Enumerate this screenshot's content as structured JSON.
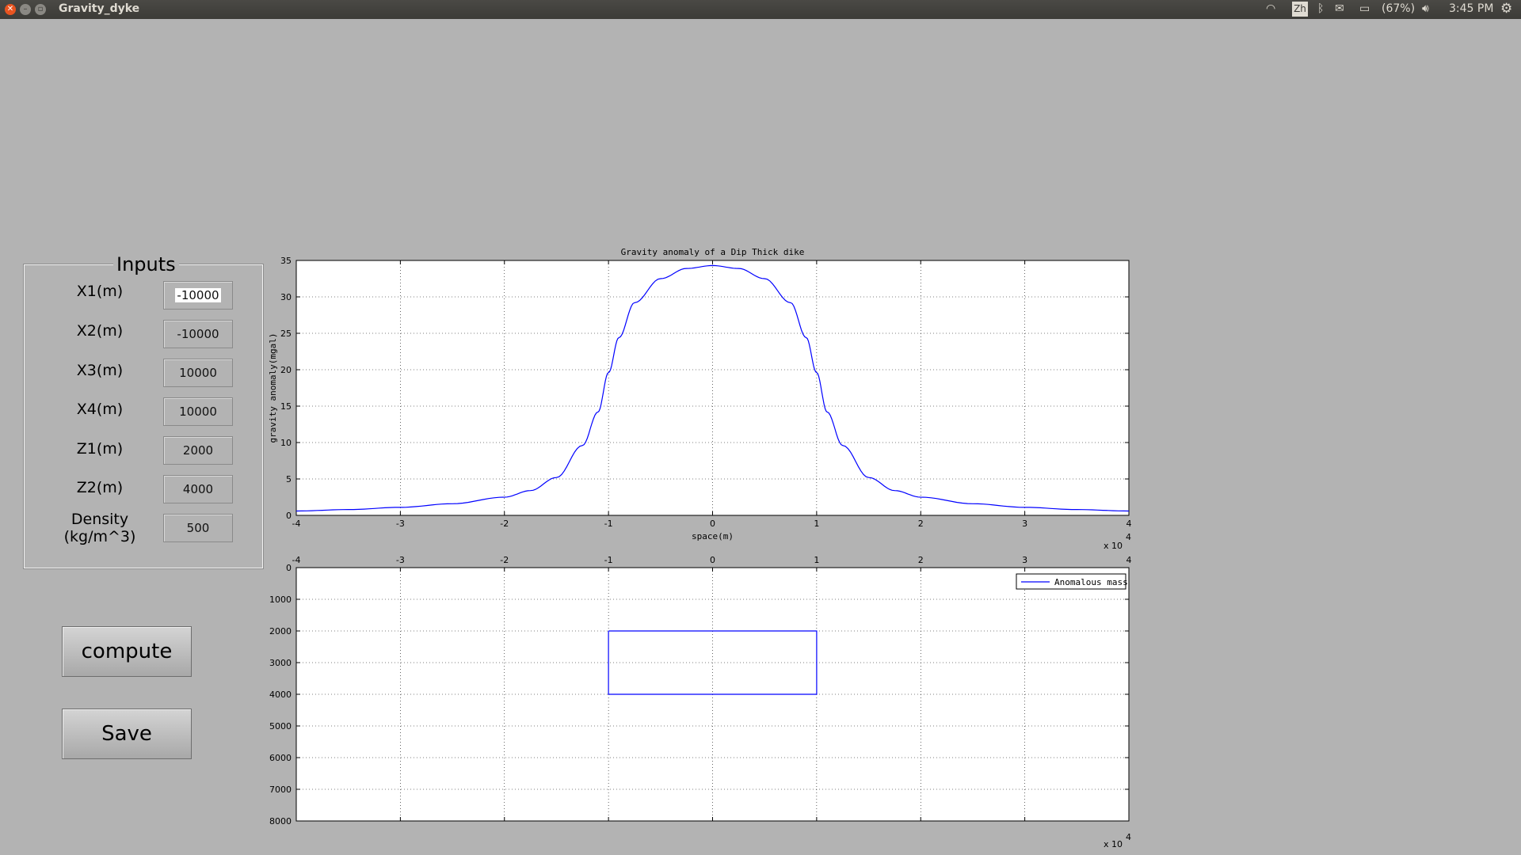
{
  "window": {
    "title": "Gravity_dyke",
    "tray": {
      "input_method": "Zh",
      "battery": "(67%)",
      "clock": "3:45 PM"
    },
    "icons": [
      "close-icon",
      "minimize-icon",
      "maximize-icon",
      "wifi-icon",
      "bluetooth-icon",
      "mail-icon",
      "battery-icon",
      "volume-icon",
      "gear-icon"
    ]
  },
  "inputs": {
    "title": "Inputs",
    "fields": [
      {
        "label": "X1(m)",
        "value": "-10000"
      },
      {
        "label": "X2(m)",
        "value": "-10000"
      },
      {
        "label": "X3(m)",
        "value": "10000"
      },
      {
        "label": "X4(m)",
        "value": "10000"
      },
      {
        "label": "Z1(m)",
        "value": "2000"
      },
      {
        "label": "Z2(m)",
        "value": "4000"
      },
      {
        "label": "Density\n(kg/m^3)",
        "value": "500"
      }
    ]
  },
  "buttons": {
    "compute": "compute",
    "save": "Save"
  },
  "chart_data": [
    {
      "type": "line",
      "title": "Gravity anomaly of a Dip Thick dike",
      "xlabel": "space(m)",
      "ylabel": "gravity anomaly(mgal)",
      "x_multiplier": "x 10",
      "x_multiplier_exp": "4",
      "xlim": [
        -40000,
        40000
      ],
      "ylim": [
        0,
        35
      ],
      "xticks": [
        "-4",
        "-3",
        "-2",
        "-1",
        "0",
        "1",
        "2",
        "3",
        "4"
      ],
      "yticks": [
        "0",
        "5",
        "10",
        "15",
        "20",
        "25",
        "30",
        "35"
      ],
      "grid": true,
      "series": [
        {
          "color": "#0000ff",
          "x": [
            -40000,
            -35000,
            -30000,
            -25000,
            -20000,
            -17500,
            -15000,
            -12500,
            -11000,
            -10000,
            -9000,
            -7500,
            -5000,
            -2500,
            0,
            2500,
            5000,
            7500,
            9000,
            10000,
            11000,
            12500,
            15000,
            17500,
            20000,
            25000,
            30000,
            35000,
            40000
          ],
          "y": [
            0.6,
            0.8,
            1.1,
            1.6,
            2.5,
            3.4,
            5.2,
            9.6,
            14.2,
            19.6,
            24.4,
            29.2,
            32.5,
            33.9,
            34.3,
            33.9,
            32.5,
            29.2,
            24.4,
            19.6,
            14.2,
            9.6,
            5.2,
            3.4,
            2.5,
            1.6,
            1.1,
            0.8,
            0.6
          ]
        }
      ]
    },
    {
      "type": "line",
      "title": "",
      "legend": "Anomalous mass",
      "legend_position": "top-right",
      "x_multiplier": "x 10",
      "x_multiplier_exp": "4",
      "xlim": [
        -40000,
        40000
      ],
      "ylim": [
        8000,
        0
      ],
      "xticks": [
        "-4",
        "-3",
        "-2",
        "-1",
        "0",
        "1",
        "2",
        "3",
        "4"
      ],
      "yticks": [
        "0",
        "1000",
        "2000",
        "3000",
        "4000",
        "5000",
        "6000",
        "7000",
        "8000"
      ],
      "x_axis_location": "top",
      "grid": true,
      "series": [
        {
          "name": "Anomalous mass",
          "color": "#0000ff",
          "x": [
            -10000,
            10000,
            10000,
            -10000,
            -10000
          ],
          "y": [
            2000,
            2000,
            4000,
            4000,
            2000
          ]
        }
      ]
    }
  ]
}
